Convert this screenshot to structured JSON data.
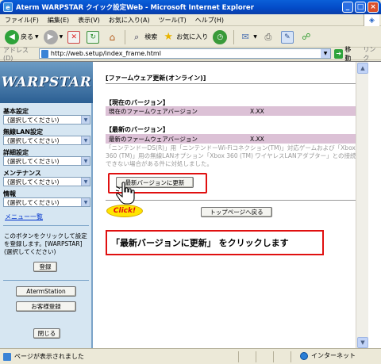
{
  "window": {
    "title": "Aterm WARPSTAR クイック設定Web - Microsoft Internet Explorer",
    "min": "_",
    "max": "□",
    "close": "×"
  },
  "menu": [
    "ファイル(F)",
    "編集(E)",
    "表示(V)",
    "お気に入り(A)",
    "ツール(T)",
    "ヘルプ(H)"
  ],
  "toolbar": {
    "back": "戻る",
    "search": "検索",
    "favorites": "お気に入り"
  },
  "address": {
    "label": "アドレス(D)",
    "url": "http://web.setup/index_frame.html",
    "go": "移動",
    "links": "リンク"
  },
  "sidebar": {
    "logo": "WARPSTAR",
    "sections": [
      {
        "label": "基本設定",
        "value": "(選択してください)"
      },
      {
        "label": "無線LAN設定",
        "value": "(選択してください)"
      },
      {
        "label": "詳細設定",
        "value": "(選択してください)"
      },
      {
        "label": "メンテナンス",
        "value": "(選択してください)"
      },
      {
        "label": "情報",
        "value": "(選択してください)"
      }
    ],
    "menu_list": "メニュー一覧",
    "note": "このボタンをクリックして設定を登録します。[WARPSTAR]",
    "note2": "(選択してください)",
    "register_button": "登録",
    "aterm_station_button": "AtermStation",
    "support_button": "お客様登録",
    "close_button": "閉じる"
  },
  "main": {
    "heading": "[ファームウェア更新(オンライン)]",
    "current_heading": "【現在のバージョン】",
    "current_label": "現在のファームウェアバージョン",
    "current_value": "X.XX",
    "latest_heading": "【最新のバージョン】",
    "latest_label": "最新のファームウェアバージョン",
    "latest_value": "X.XX",
    "notice": "「ニンテンドーDS(R)」用「ニンテンドーWi-Fiコネクション(TM)」対応ゲームおよび「Xbox 360 (TM)」用の無線LANオプション「Xbox 360 (TM) ワイヤレスLANアダプター」との接続ができない場合がある件に対処しました。",
    "update_button": "最新バージョンに更新",
    "top_button": "トップページへ戻る",
    "click_badge": "Click!",
    "callout": "「最新バージョンに更新」 をクリックします"
  },
  "status": {
    "text": "ページが表示されました",
    "zone": "インターネット"
  },
  "colors": {
    "accent_red": "#e01010",
    "version_row": "#dcc1d6",
    "sidebar_bg": "#d6e6f2"
  }
}
